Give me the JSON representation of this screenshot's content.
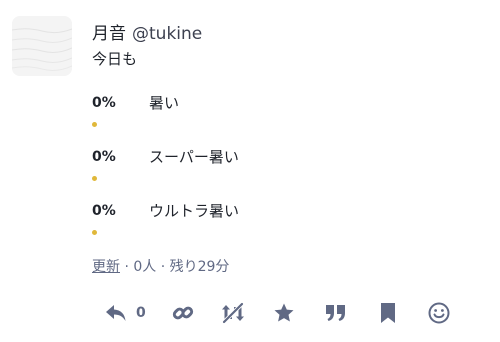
{
  "author": {
    "display_name": "月音",
    "username": "@tukine"
  },
  "post": {
    "text": "今日も"
  },
  "poll": {
    "options": [
      {
        "percent": "0%",
        "label": "暑い",
        "fraction": 0
      },
      {
        "percent": "0%",
        "label": "スーパー暑い",
        "fraction": 0
      },
      {
        "percent": "0%",
        "label": "ウルトラ暑い",
        "fraction": 0
      }
    ],
    "refresh_label": "更新",
    "meta": " · 0人 · 残り29分"
  },
  "actions": {
    "reply_count": "0"
  },
  "colors": {
    "icon": "#606984",
    "poll_bar": "#e0b83a",
    "text": "#1f232b"
  }
}
